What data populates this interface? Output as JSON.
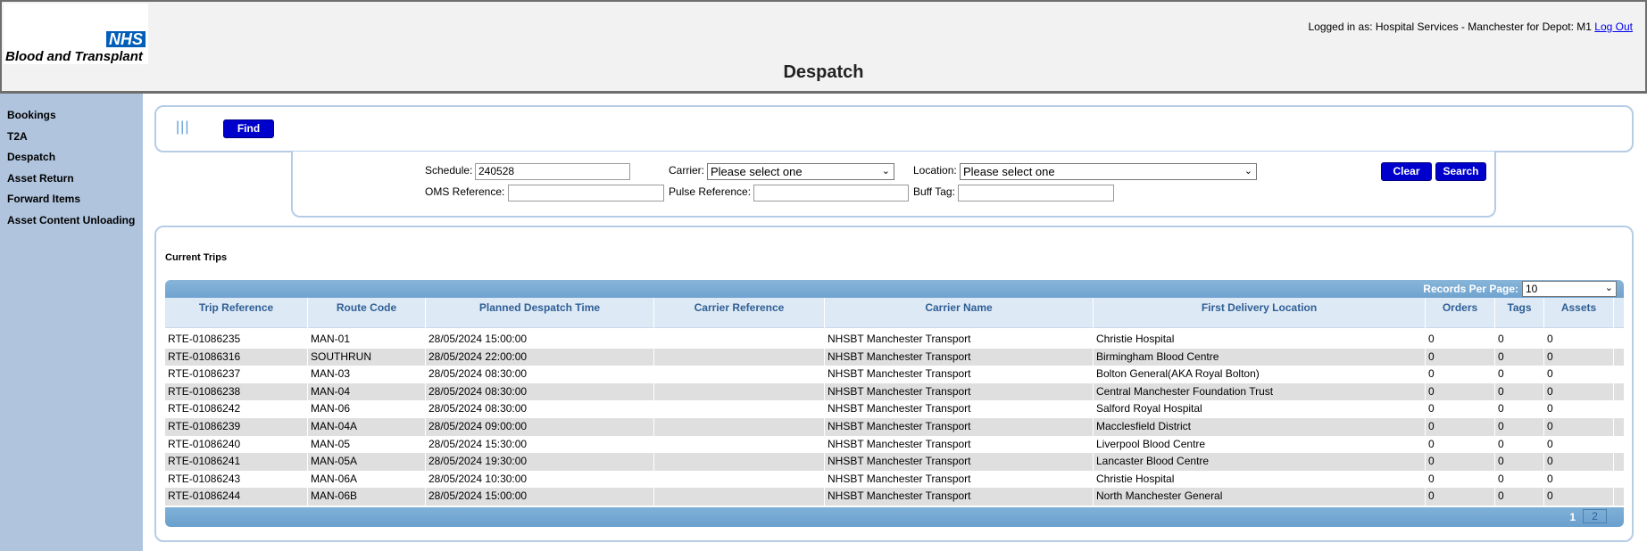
{
  "header": {
    "logo_nhs": "NHS",
    "logo_text": "Blood and Transplant",
    "login_text": "Logged in as: Hospital Services - Manchester for Depot: M1",
    "logout_label": "Log Out",
    "page_title": "Despatch"
  },
  "sidebar": {
    "items": [
      {
        "label": "Bookings"
      },
      {
        "label": "T2A"
      },
      {
        "label": "Despatch"
      },
      {
        "label": "Asset Return"
      },
      {
        "label": "Forward Items"
      },
      {
        "label": "Asset Content Unloading"
      }
    ]
  },
  "find": {
    "menu_icon": "menu-bars-icon",
    "find_label": "Find"
  },
  "search": {
    "schedule_label": "Schedule:",
    "schedule_value": "240528",
    "carrier_label": "Carrier:",
    "carrier_value": "Please select one",
    "location_label": "Location:",
    "location_value": "Please select one",
    "oms_label": "OMS Reference:",
    "oms_value": "",
    "pulse_label": "Pulse Reference:",
    "pulse_value": "",
    "buff_label": "Buff Tag:",
    "buff_value": "",
    "clear_label": "Clear",
    "search_label": "Search"
  },
  "results": {
    "title": "Current Trips",
    "rpp_label": "Records Per Page:",
    "rpp_value": "10",
    "columns": [
      "Trip Reference",
      "Route Code",
      "Planned Despatch Time",
      "Carrier Reference",
      "Carrier Name",
      "First Delivery Location",
      "Orders",
      "Tags",
      "Assets"
    ],
    "rows": [
      [
        "RTE-01086235",
        "MAN-01",
        "28/05/2024 15:00:00",
        "",
        "NHSBT Manchester Transport",
        "Christie Hospital",
        "0",
        "0",
        "0"
      ],
      [
        "RTE-01086316",
        "SOUTHRUN",
        "28/05/2024 22:00:00",
        "",
        "NHSBT Manchester Transport",
        "Birmingham Blood Centre",
        "0",
        "0",
        "0"
      ],
      [
        "RTE-01086237",
        "MAN-03",
        "28/05/2024 08:30:00",
        "",
        "NHSBT Manchester Transport",
        "Bolton General(AKA Royal Bolton)",
        "0",
        "0",
        "0"
      ],
      [
        "RTE-01086238",
        "MAN-04",
        "28/05/2024 08:30:00",
        "",
        "NHSBT Manchester Transport",
        "Central Manchester Foundation Trust",
        "0",
        "0",
        "0"
      ],
      [
        "RTE-01086242",
        "MAN-06",
        "28/05/2024 08:30:00",
        "",
        "NHSBT Manchester Transport",
        "Salford Royal Hospital",
        "0",
        "0",
        "0"
      ],
      [
        "RTE-01086239",
        "MAN-04A",
        "28/05/2024 09:00:00",
        "",
        "NHSBT Manchester Transport",
        "Macclesfield District",
        "0",
        "0",
        "0"
      ],
      [
        "RTE-01086240",
        "MAN-05",
        "28/05/2024 15:30:00",
        "",
        "NHSBT Manchester Transport",
        "Liverpool Blood Centre",
        "0",
        "0",
        "0"
      ],
      [
        "RTE-01086241",
        "MAN-05A",
        "28/05/2024 19:30:00",
        "",
        "NHSBT Manchester Transport",
        "Lancaster Blood Centre",
        "0",
        "0",
        "0"
      ],
      [
        "RTE-01086243",
        "MAN-06A",
        "28/05/2024 10:30:00",
        "",
        "NHSBT Manchester Transport",
        "Christie Hospital",
        "0",
        "0",
        "0"
      ],
      [
        "RTE-01086244",
        "MAN-06B",
        "28/05/2024 15:00:00",
        "",
        "NHSBT Manchester Transport",
        "North Manchester General",
        "0",
        "0",
        "0"
      ]
    ],
    "pages": [
      "1",
      "2"
    ],
    "current_page": "1"
  }
}
